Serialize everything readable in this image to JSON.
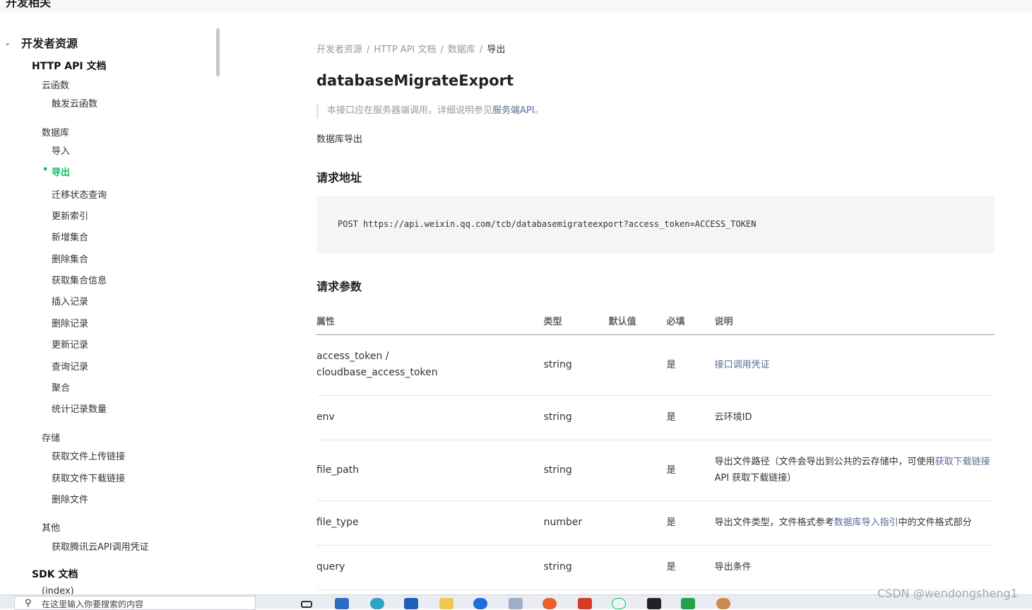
{
  "top_cut_text": "开发相关",
  "sidebar": {
    "group": "开发者资源",
    "items": [
      {
        "label": "HTTP API 文档",
        "level": "h2"
      },
      {
        "label": "云函数",
        "level": "l2"
      },
      {
        "label": "触发云函数",
        "level": "l3"
      },
      {
        "label": "数据库",
        "level": "l2"
      },
      {
        "label": "导入",
        "level": "l3"
      },
      {
        "label": "导出",
        "level": "l3",
        "active": true
      },
      {
        "label": "迁移状态查询",
        "level": "l3"
      },
      {
        "label": "更新索引",
        "level": "l3"
      },
      {
        "label": "新增集合",
        "level": "l3"
      },
      {
        "label": "删除集合",
        "level": "l3"
      },
      {
        "label": "获取集合信息",
        "level": "l3"
      },
      {
        "label": "插入记录",
        "level": "l3"
      },
      {
        "label": "删除记录",
        "level": "l3"
      },
      {
        "label": "更新记录",
        "level": "l3"
      },
      {
        "label": "查询记录",
        "level": "l3"
      },
      {
        "label": "聚合",
        "level": "l3"
      },
      {
        "label": "统计记录数量",
        "level": "l3"
      },
      {
        "label": "存储",
        "level": "l2"
      },
      {
        "label": "获取文件上传链接",
        "level": "l3"
      },
      {
        "label": "获取文件下载链接",
        "level": "l3"
      },
      {
        "label": "删除文件",
        "level": "l3"
      },
      {
        "label": "其他",
        "level": "l2"
      },
      {
        "label": "获取腾讯云API调用凭证",
        "level": "l3"
      },
      {
        "label": "SDK 文档",
        "level": "h2"
      },
      {
        "label": "(index)",
        "level": "l2"
      }
    ]
  },
  "breadcrumb": [
    "开发者资源",
    "HTTP API 文档",
    "数据库",
    "导出"
  ],
  "title": "databaseMigrateExport",
  "note": {
    "text": "本接口应在服务器端调用，详细说明参见",
    "link": "服务端API",
    "suffix": "。"
  },
  "description": "数据库导出",
  "section_url": "请求地址",
  "request_url": "POST https://api.weixin.qq.com/tcb/databasemigrateexport?access_token=ACCESS_TOKEN",
  "section_params": "请求参数",
  "table": {
    "headers": [
      "属性",
      "类型",
      "默认值",
      "必填",
      "说明"
    ],
    "rows": [
      {
        "name": "access_token / cloudbase_access_token",
        "type": "string",
        "default": "",
        "required": "是",
        "desc": "",
        "desc_link": "接口调用凭证",
        "desc_after": ""
      },
      {
        "name": "env",
        "type": "string",
        "default": "",
        "required": "是",
        "desc": "云环境ID",
        "desc_link": "",
        "desc_after": ""
      },
      {
        "name": "file_path",
        "type": "string",
        "default": "",
        "required": "是",
        "desc": "导出文件路径（文件会导出到公共的云存储中，可使用",
        "desc_link": "获取下载链接",
        "desc_after": " API 获取下载链接）"
      },
      {
        "name": "file_type",
        "type": "number",
        "default": "",
        "required": "是",
        "desc": "导出文件类型，文件格式参考",
        "desc_link": "数据库导入指引",
        "desc_after": "中的文件格式部分"
      },
      {
        "name": "query",
        "type": "string",
        "default": "",
        "required": "是",
        "desc": "导出条件",
        "desc_link": "",
        "desc_after": ""
      }
    ]
  },
  "taskbar": {
    "search_placeholder": "在这里输入你要搜索的内容"
  },
  "watermark": "CSDN @wendongsheng1"
}
